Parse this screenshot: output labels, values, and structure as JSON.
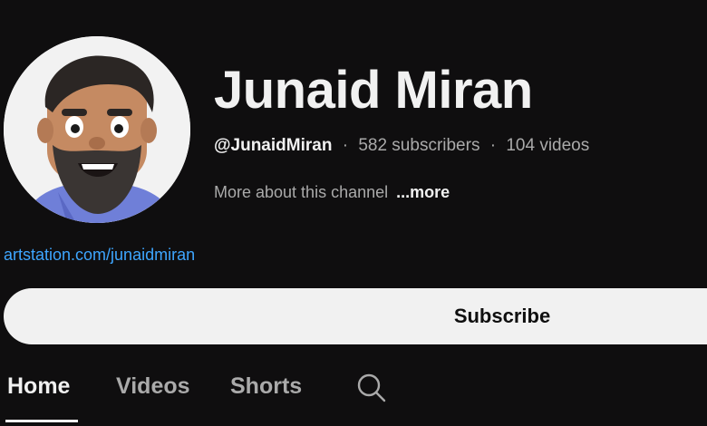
{
  "channel": {
    "name": "Junaid Miran",
    "handle": "@JunaidMiran",
    "subscribers": "582 subscribers",
    "videos": "104 videos",
    "separator": "·"
  },
  "about": {
    "text": "More about this channel",
    "more_label": "...more"
  },
  "link": {
    "text": "artstation.com/junaidmiran"
  },
  "subscribe": {
    "label": "Subscribe"
  },
  "tabs": [
    {
      "label": "Home",
      "active": true
    },
    {
      "label": "Videos",
      "active": false
    },
    {
      "label": "Shorts",
      "active": false
    }
  ],
  "icons": {
    "search": "search-icon",
    "avatar": "avatar"
  },
  "colors": {
    "background": "#0f0e0f",
    "text_primary": "#f1f1f1",
    "text_secondary": "#aaaaaa",
    "link": "#3ea6ff",
    "subscribe_bg": "#f1f1f1"
  }
}
